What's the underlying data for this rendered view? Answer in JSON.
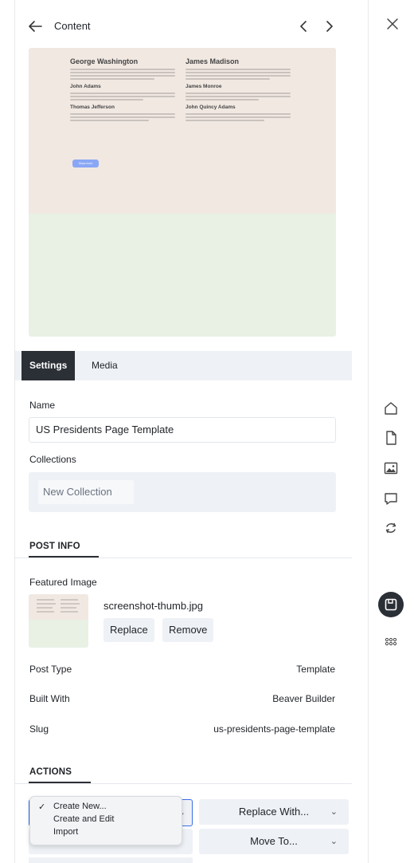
{
  "header": {
    "title": "Content",
    "icons": {
      "back": "arrow-left-icon",
      "prev": "chevron-left-icon",
      "next": "chevron-right-icon"
    }
  },
  "preview": {
    "col1": [
      {
        "heading": "George Washington",
        "size": "big"
      },
      {
        "heading": "John Adams",
        "size": "small"
      },
      {
        "heading": "Thomas Jefferson",
        "size": "small"
      }
    ],
    "col2": [
      {
        "heading": "James Madison",
        "size": "big"
      },
      {
        "heading": "James Monroe",
        "size": "small"
      },
      {
        "heading": "John Quincy Adams",
        "size": "small"
      }
    ],
    "button_label": "Show more"
  },
  "tabs": [
    {
      "label": "Settings",
      "active": true
    },
    {
      "label": "Media",
      "active": false
    }
  ],
  "settings": {
    "name_label": "Name",
    "name_value": "US Presidents Page Template",
    "collections_label": "Collections",
    "collections_placeholder": "New Collection"
  },
  "post_info": {
    "section_title": "POST INFO",
    "featured_image_label": "Featured Image",
    "featured_image_file": "screenshot-thumb.jpg",
    "replace_label": "Replace",
    "remove_label": "Remove",
    "rows": [
      {
        "label": "Post Type",
        "value": "Template"
      },
      {
        "label": "Built With",
        "value": "Beaver Builder"
      },
      {
        "label": "Slug",
        "value": "us-presidents-page-template"
      }
    ]
  },
  "actions": {
    "section_title": "ACTIONS",
    "replace_with_label": "Replace With...",
    "move_to_label": "Move To...",
    "dropdown_items": [
      {
        "label": "Create New...",
        "checked": true
      },
      {
        "label": "Create and Edit",
        "checked": false
      },
      {
        "label": "Import",
        "checked": false
      }
    ]
  },
  "rail": {
    "icons": [
      "close-icon",
      "home-icon",
      "document-icon",
      "image-icon",
      "comment-icon",
      "sync-icon",
      "saved-icon",
      "grid-icon"
    ],
    "active": "saved-icon"
  },
  "colors": {
    "accent": "#3a6ee8",
    "dark": "#2b2f36",
    "panel_bg": "#eef1f5"
  }
}
